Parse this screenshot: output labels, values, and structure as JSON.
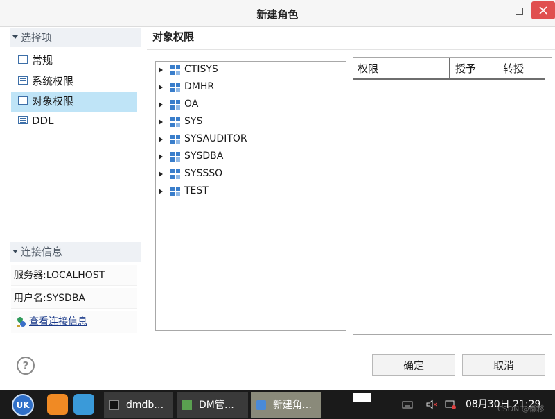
{
  "window": {
    "title": "新建角色"
  },
  "sidebar": {
    "section_title": "选择项",
    "items": [
      {
        "label": "常规",
        "selected": false
      },
      {
        "label": "系统权限",
        "selected": false
      },
      {
        "label": "对象权限",
        "selected": true
      },
      {
        "label": "DDL",
        "selected": false
      }
    ],
    "connection": {
      "section_title": "连接信息",
      "server_label": "服务器:",
      "server_value": "LOCALHOST",
      "user_label": "用户名:",
      "user_value": "SYSDBA",
      "link_text": "查看连接信息"
    }
  },
  "main": {
    "title": "对象权限",
    "tree": [
      {
        "label": "CTISYS",
        "icon": "schema-icon"
      },
      {
        "label": "DMHR",
        "icon": "schema-icon"
      },
      {
        "label": "OA",
        "icon": "schema-icon"
      },
      {
        "label": "SYS",
        "icon": "schema-icon"
      },
      {
        "label": "SYSAUDITOR",
        "icon": "schema-icon"
      },
      {
        "label": "SYSDBA",
        "icon": "schema-icon"
      },
      {
        "label": "SYSSSO",
        "icon": "schema-icon"
      },
      {
        "label": "TEST",
        "icon": "schema-icon"
      }
    ],
    "grid": {
      "columns": [
        "权限",
        "授予",
        "转授"
      ],
      "rows": []
    }
  },
  "footer": {
    "help_label": "?",
    "ok_label": "确定",
    "cancel_label": "取消"
  },
  "taskbar": {
    "launcher_label": "UK",
    "tasks": [
      {
        "label": "dmdb…",
        "icon": "terminal-icon",
        "active": false
      },
      {
        "label": "DM管…",
        "icon": "dm-manager-icon",
        "active": false
      },
      {
        "label": "新建角…",
        "icon": "java-icon",
        "active": true
      }
    ],
    "clock": "08月30日 21:29",
    "watermark": "CSDN @懒移"
  },
  "colors": {
    "selection": "#bfe4f7",
    "close_button": "#e05050",
    "taskbar": "#1a1a1a",
    "schema_icon": "#3a7ecb"
  }
}
